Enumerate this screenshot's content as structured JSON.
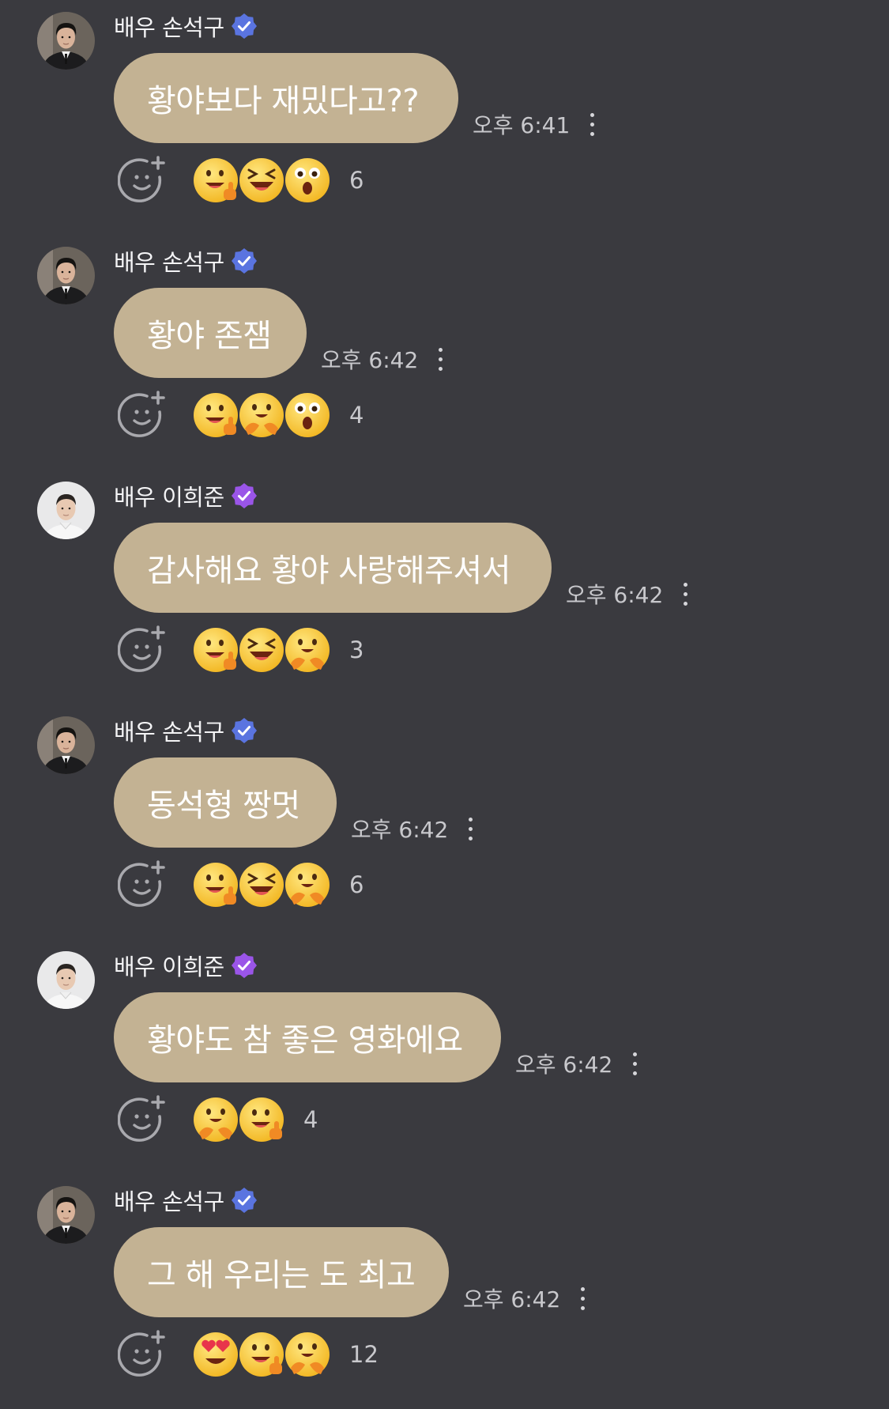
{
  "colors": {
    "background": "#3a3a3f",
    "bubble": "#c3b293",
    "badge_blue": "#5a74e0",
    "badge_purple": "#9a55e8"
  },
  "messages": [
    {
      "sender": "배우 손석구",
      "avatar": "avatar-son-seokku",
      "badge": "blue",
      "text": "황야보다 재밌다고??",
      "time": "오후 6:41",
      "reactions": [
        "thumbs-up-smile-emoji",
        "laughing-emoji",
        "surprised-emoji"
      ],
      "reaction_count": "6"
    },
    {
      "sender": "배우 손석구",
      "avatar": "avatar-son-seokku",
      "badge": "blue",
      "text": "황야 존잼",
      "time": "오후 6:42",
      "reactions": [
        "thumbs-up-smile-emoji",
        "hug-emoji",
        "surprised-emoji"
      ],
      "reaction_count": "4"
    },
    {
      "sender": "배우 이희준",
      "avatar": "avatar-lee-heejun",
      "badge": "purple",
      "text": "감사해요 황야 사랑해주셔서",
      "time": "오후 6:42",
      "reactions": [
        "thumbs-up-smile-emoji",
        "laughing-emoji",
        "hug-emoji"
      ],
      "reaction_count": "3"
    },
    {
      "sender": "배우 손석구",
      "avatar": "avatar-son-seokku",
      "badge": "blue",
      "text": "동석형 짱멋",
      "time": "오후 6:42",
      "reactions": [
        "thumbs-up-smile-emoji",
        "laughing-emoji",
        "hug-emoji"
      ],
      "reaction_count": "6"
    },
    {
      "sender": "배우 이희준",
      "avatar": "avatar-lee-heejun",
      "badge": "purple",
      "text": "황야도 참 좋은 영화에요",
      "time": "오후 6:42",
      "reactions": [
        "hug-emoji",
        "thumbs-up-smile-emoji"
      ],
      "reaction_count": "4"
    },
    {
      "sender": "배우 손석구",
      "avatar": "avatar-son-seokku",
      "badge": "blue",
      "text": "그 해 우리는 도 최고",
      "time": "오후 6:42",
      "reactions": [
        "heart-eyes-emoji",
        "thumbs-up-smile-emoji",
        "hug-emoji"
      ],
      "reaction_count": "12"
    }
  ]
}
